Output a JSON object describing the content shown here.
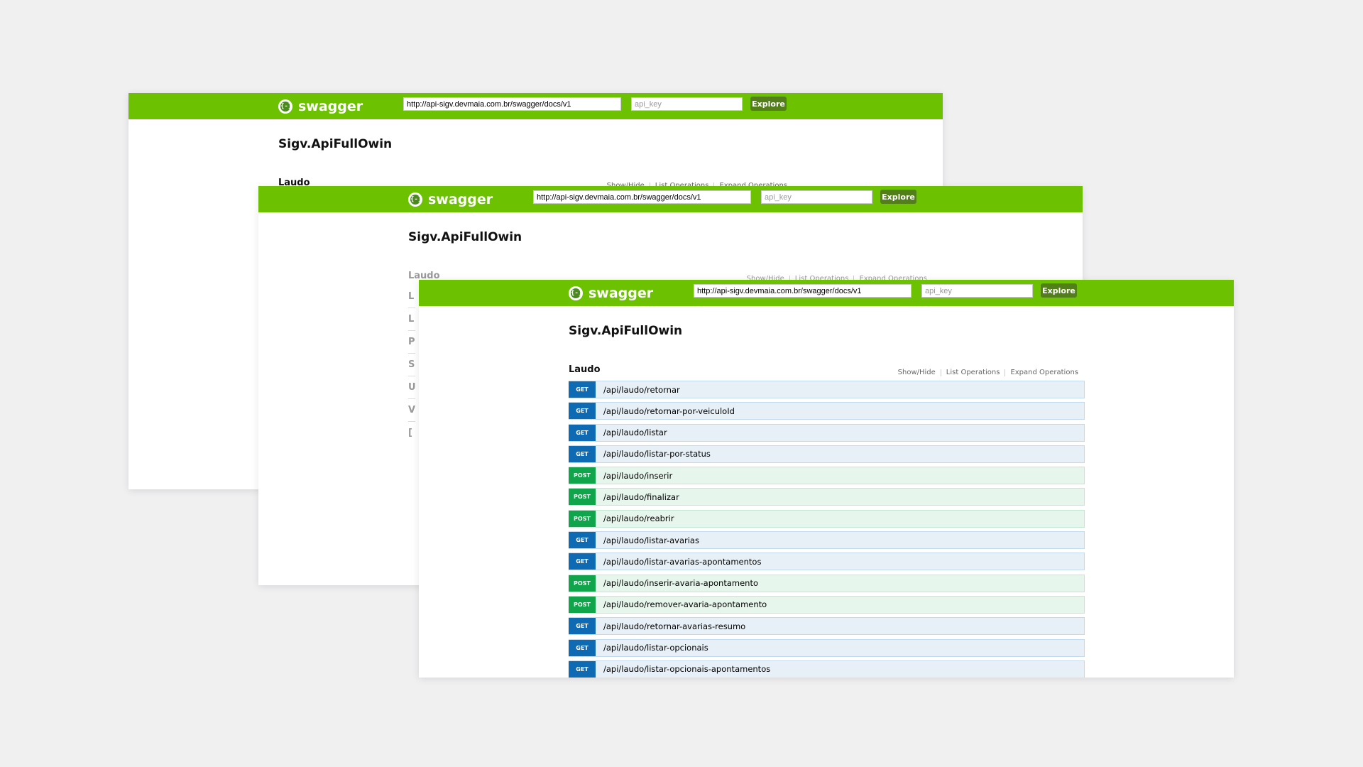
{
  "brand": {
    "name": "swagger",
    "logo_glyph": "{-}"
  },
  "topbar": {
    "url_value": "http://api-sigv.devmaia.com.br/swagger/docs/v1",
    "api_key_placeholder": "api_key",
    "explore_label": "Explore"
  },
  "api_title": "Sigv.ApiFullOwin",
  "section": {
    "title": "Laudo",
    "links": {
      "show_hide": "Show/Hide",
      "list_operations": "List Operations",
      "expand_operations": "Expand Operations"
    }
  },
  "partial_section_letters": [
    "L",
    "L",
    "P",
    "S",
    "U",
    "V",
    "["
  ],
  "operations": [
    {
      "method": "GET",
      "path": "/api/laudo/retornar"
    },
    {
      "method": "GET",
      "path": "/api/laudo/retornar-por-veiculoId"
    },
    {
      "method": "GET",
      "path": "/api/laudo/listar"
    },
    {
      "method": "GET",
      "path": "/api/laudo/listar-por-status"
    },
    {
      "method": "POST",
      "path": "/api/laudo/inserir"
    },
    {
      "method": "POST",
      "path": "/api/laudo/finalizar"
    },
    {
      "method": "POST",
      "path": "/api/laudo/reabrir"
    },
    {
      "method": "GET",
      "path": "/api/laudo/listar-avarias"
    },
    {
      "method": "GET",
      "path": "/api/laudo/listar-avarias-apontamentos"
    },
    {
      "method": "POST",
      "path": "/api/laudo/inserir-avaria-apontamento"
    },
    {
      "method": "POST",
      "path": "/api/laudo/remover-avaria-apontamento"
    },
    {
      "method": "GET",
      "path": "/api/laudo/retornar-avarias-resumo"
    },
    {
      "method": "GET",
      "path": "/api/laudo/listar-opcionais"
    },
    {
      "method": "GET",
      "path": "/api/laudo/listar-opcionais-apontamentos"
    }
  ],
  "colors": {
    "topbar": "#6cc100",
    "explore_button": "#537f1b",
    "get_badge": "#0f6ab4",
    "post_badge": "#10a54a",
    "get_row": "#e7f0f7",
    "post_row": "#e7f6ec"
  }
}
